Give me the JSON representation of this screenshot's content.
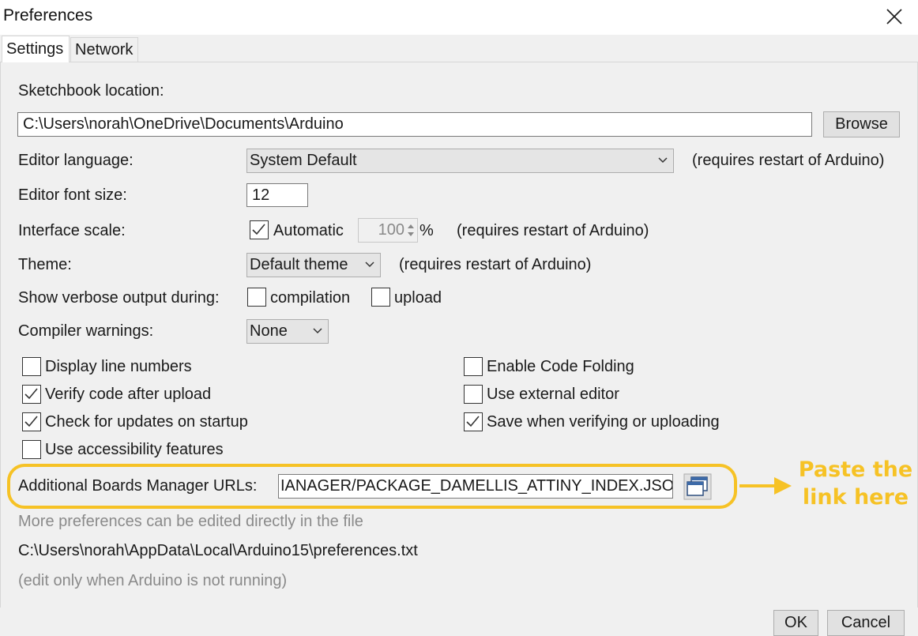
{
  "window": {
    "title": "Preferences"
  },
  "tabs": [
    {
      "label": "Settings",
      "active": true
    },
    {
      "label": "Network",
      "active": false
    }
  ],
  "sketchbook": {
    "label": "Sketchbook location:",
    "path": "C:\\Users\\norah\\OneDrive\\Documents\\Arduino",
    "browse_label": "Browse"
  },
  "editor_language": {
    "label": "Editor language:",
    "value": "System Default",
    "note": "(requires restart of Arduino)"
  },
  "font_size": {
    "label": "Editor font size:",
    "value": "12"
  },
  "interface_scale": {
    "label": "Interface scale:",
    "automatic_label": "Automatic",
    "automatic_checked": true,
    "value": "100",
    "unit": "%",
    "note": "(requires restart of Arduino)"
  },
  "theme": {
    "label": "Theme:",
    "value": "Default theme",
    "note": "(requires restart of Arduino)"
  },
  "verbose": {
    "label": "Show verbose output during:",
    "compilation_label": "compilation",
    "compilation_checked": false,
    "upload_label": "upload",
    "upload_checked": false
  },
  "compiler_warnings": {
    "label": "Compiler warnings:",
    "value": "None"
  },
  "options": {
    "display_line_numbers": {
      "label": "Display line numbers",
      "checked": false
    },
    "verify_after_upload": {
      "label": "Verify code after upload",
      "checked": true
    },
    "check_updates": {
      "label": "Check for updates on startup",
      "checked": true
    },
    "accessibility": {
      "label": "Use accessibility features",
      "checked": false
    },
    "code_folding": {
      "label": "Enable Code Folding",
      "checked": false
    },
    "external_editor": {
      "label": "Use external editor",
      "checked": false
    },
    "save_when_verifying": {
      "label": "Save when verifying or uploading",
      "checked": true
    }
  },
  "boards_manager": {
    "label": "Additional Boards Manager URLs:",
    "value": "IANAGER/PACKAGE_DAMELLIS_ATTINY_INDEX.JSON"
  },
  "footer_info": {
    "line1": "More preferences can be edited directly in the file",
    "path": "C:\\Users\\norah\\AppData\\Local\\Arduino15\\preferences.txt",
    "line3": "(edit only when Arduino is not running)"
  },
  "buttons": {
    "ok": "OK",
    "cancel": "Cancel"
  },
  "annotation": {
    "line1": "Paste the",
    "line2": "link here"
  },
  "colors": {
    "accent": "#f6c225",
    "panel": "#f0f0f0",
    "grey_text": "#8a8a8a"
  },
  "icons": {
    "close": "close-icon",
    "dropdown": "chevron-down-icon",
    "spinner": "spinner-arrows-icon",
    "check": "check-icon",
    "url_editor": "window-stack-icon",
    "arrow": "arrow-right-icon"
  }
}
